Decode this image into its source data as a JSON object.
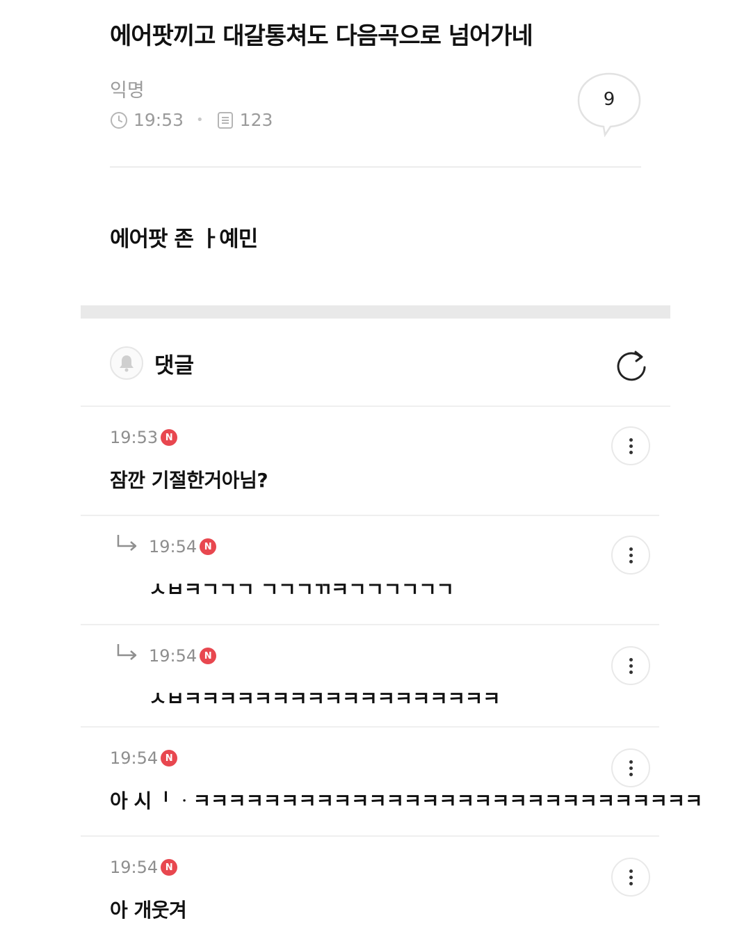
{
  "post": {
    "title": "에어팟끼고 대갈통쳐도 다음곡으로 넘어가네",
    "author": "익명",
    "time": "19:53",
    "views": "123",
    "comment_count": "9",
    "body": "에어팟 존 ㅏ예민"
  },
  "comments_section": {
    "label": "댓글"
  },
  "comments": [
    {
      "time": "19:53",
      "badge": "N",
      "text": "잠깐 기절한거아님?",
      "is_reply": false
    },
    {
      "time": "19:54",
      "badge": "N",
      "text": "ㅅㅂㅋㄱㄱㄱ ㄱㄱㄱㄲㅋㄱㄱㄱㄱㄱㄱ",
      "is_reply": true
    },
    {
      "time": "19:54",
      "badge": "N",
      "text": "ㅅㅂㅋㅋㅋㅋㅋㅋㅋㅋㅋㅋㅋㅋㅋㅋㅋㅋㅋㅋ",
      "is_reply": true
    },
    {
      "time": "19:54",
      "badge": "N",
      "text": "아 시ᅵ ᆞㅋㅋㅋㅋㅋㅋㅋㅋㅋㅋㅋㅋㅋㅋㅋㅋㅋㅋㅋㅋㅋㅋㅋㅋㅋㅋㅋㅋㅋ",
      "is_reply": false
    },
    {
      "time": "19:54",
      "badge": "N",
      "text": "아 개웃겨",
      "is_reply": false
    }
  ],
  "icons": {
    "clock": "clock-icon",
    "views": "document-icon",
    "comment_bubble": "speech-bubble-icon",
    "bell": "bell-icon",
    "refresh": "refresh-icon",
    "reply": "reply-arrow-icon",
    "more": "more-vertical-icon"
  },
  "colors": {
    "badge": "#e8474f",
    "meta_text": "#9b9b9b",
    "divider": "#ececec"
  }
}
